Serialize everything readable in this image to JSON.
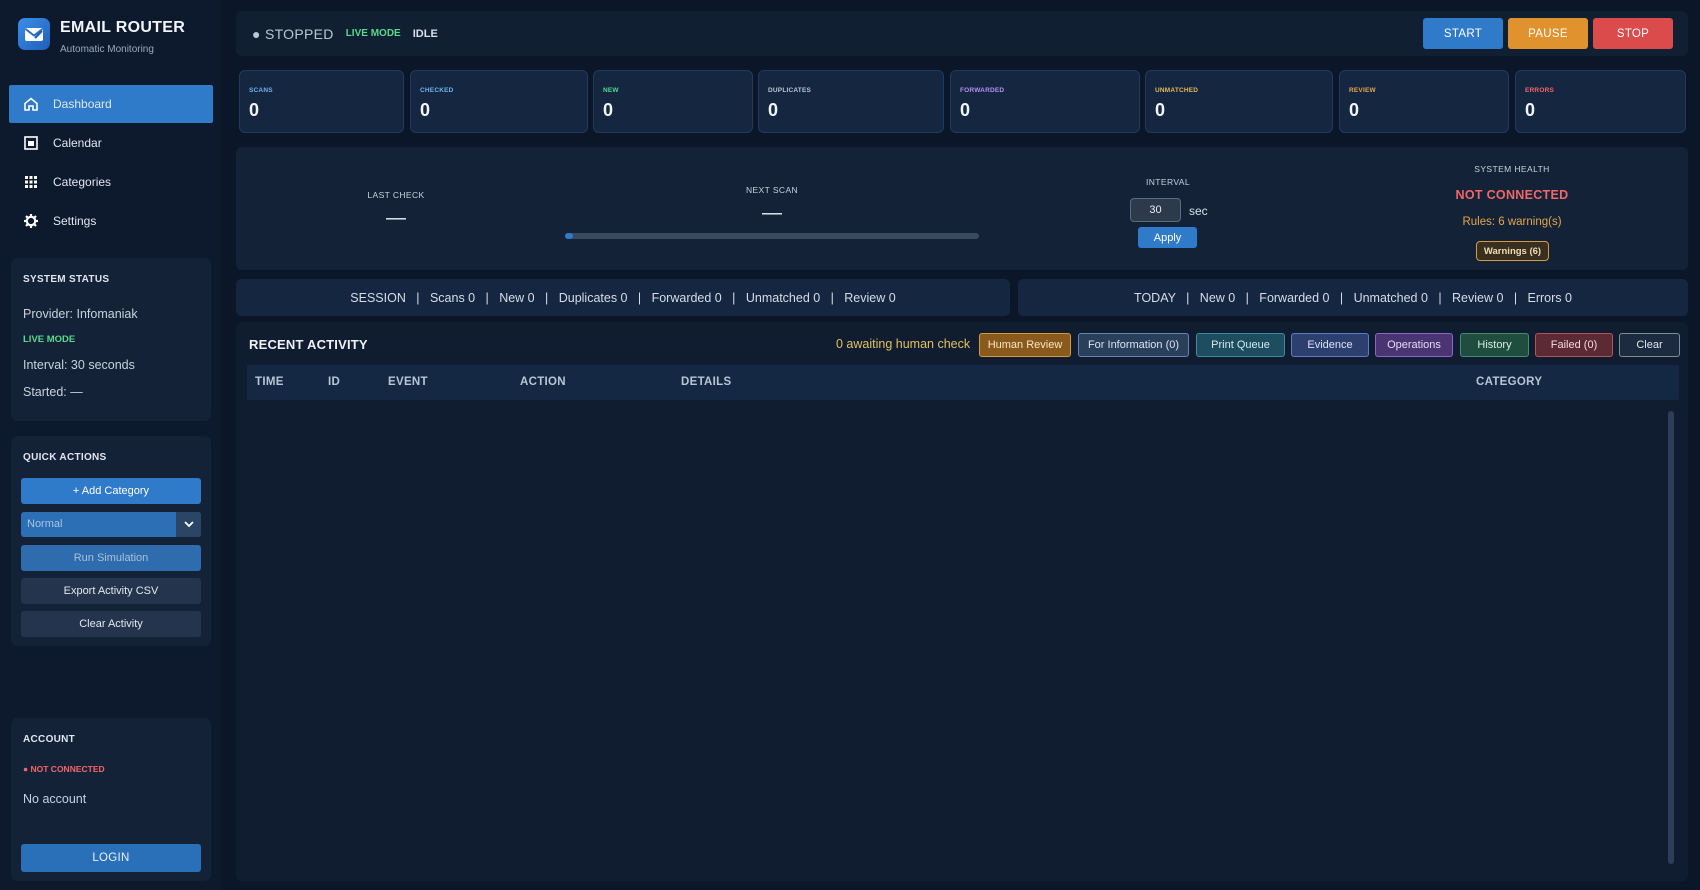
{
  "brand": {
    "title": "EMAIL ROUTER",
    "subtitle": "Automatic Monitoring"
  },
  "nav": [
    {
      "label": "Dashboard",
      "icon": "home-icon",
      "active": true
    },
    {
      "label": "Calendar",
      "icon": "calendar-icon"
    },
    {
      "label": "Categories",
      "icon": "grid-icon"
    },
    {
      "label": "Settings",
      "icon": "gear-icon"
    }
  ],
  "system_status": {
    "title": "SYSTEM STATUS",
    "provider": "Provider: Infomaniak",
    "mode": "LIVE MODE",
    "interval": "Interval: 30 seconds",
    "started": "Started: —"
  },
  "quick_actions": {
    "title": "QUICK ACTIONS",
    "add_category": "+ Add Category",
    "select_value": "Normal",
    "run_simulation": "Run Simulation",
    "export_csv": "Export Activity CSV",
    "clear_activity": "Clear Activity"
  },
  "account": {
    "title": "ACCOUNT",
    "status": "● NOT CONNECTED",
    "name": "No account",
    "login": "LOGIN"
  },
  "topbar": {
    "status": "● STOPPED",
    "mode": "LIVE MODE",
    "state": "IDLE",
    "start": "START",
    "pause": "PAUSE",
    "stop": "STOP"
  },
  "stats": [
    {
      "label": "SCANS",
      "value": "0",
      "color": "#6fb2f0"
    },
    {
      "label": "CHECKED",
      "value": "0",
      "color": "#6fb2f0"
    },
    {
      "label": "NEW",
      "value": "0",
      "color": "#59d98a"
    },
    {
      "label": "DUPLICATES",
      "value": "0",
      "color": "#b9c5d4"
    },
    {
      "label": "FORWARDED",
      "value": "0",
      "color": "#b68ef0"
    },
    {
      "label": "UNMATCHED",
      "value": "0",
      "color": "#e4b85a"
    },
    {
      "label": "REVIEW",
      "value": "0",
      "color": "#e4a64a"
    },
    {
      "label": "ERRORS",
      "value": "0",
      "color": "#f26767"
    }
  ],
  "info": {
    "last_check_label": "LAST CHECK",
    "last_check_value": "—",
    "next_scan_label": "NEXT SCAN",
    "next_scan_value": "—",
    "next_scan_progress": 0.02,
    "interval_label": "INTERVAL",
    "interval_value": "30",
    "interval_unit": "sec",
    "apply": "Apply",
    "health_label": "SYSTEM HEALTH",
    "health_value": "NOT CONNECTED",
    "health_rules": "Rules: 6 warning(s)",
    "warnings_badge": "Warnings (6)"
  },
  "summary": {
    "session": "SESSION   |   Scans 0   |   New 0   |   Duplicates 0   |   Forwarded 0   |   Unmatched 0   |   Review 0",
    "today": "TODAY   |   New 0   |   Forwarded 0   |   Unmatched 0   |   Review 0   |   Errors 0"
  },
  "activity": {
    "title": "RECENT ACTIVITY",
    "awaiting": "0 awaiting human check",
    "filters": [
      {
        "label": "Human Review",
        "bg": "#8a5a1c",
        "border": "#d59a3d",
        "fg": "#f7e6c4"
      },
      {
        "label": "For Information (0)",
        "bg": "#2a3f5c",
        "border": "#6585ad",
        "fg": "#d9e3ef"
      },
      {
        "label": "Print Queue",
        "bg": "#1d4d5e",
        "border": "#3f8aa3",
        "fg": "#d2ebf2"
      },
      {
        "label": "Evidence",
        "bg": "#2c3f6e",
        "border": "#5e7cc4",
        "fg": "#dbe3f7"
      },
      {
        "label": "Operations",
        "bg": "#4a3472",
        "border": "#8a67c7",
        "fg": "#e6dbf6"
      },
      {
        "label": "History",
        "bg": "#1f4d3e",
        "border": "#3f8f72",
        "fg": "#d2ede3"
      },
      {
        "label": "Failed (0)",
        "bg": "#5c2a32",
        "border": "#b2525e",
        "fg": "#f5dadd"
      },
      {
        "label": "Clear",
        "bg": "#1c2b3f",
        "border": "#7c8ca1",
        "fg": "#dfe6ef"
      }
    ],
    "columns": [
      "TIME",
      "ID",
      "EVENT",
      "ACTION",
      "DETAILS",
      "CATEGORY"
    ]
  }
}
